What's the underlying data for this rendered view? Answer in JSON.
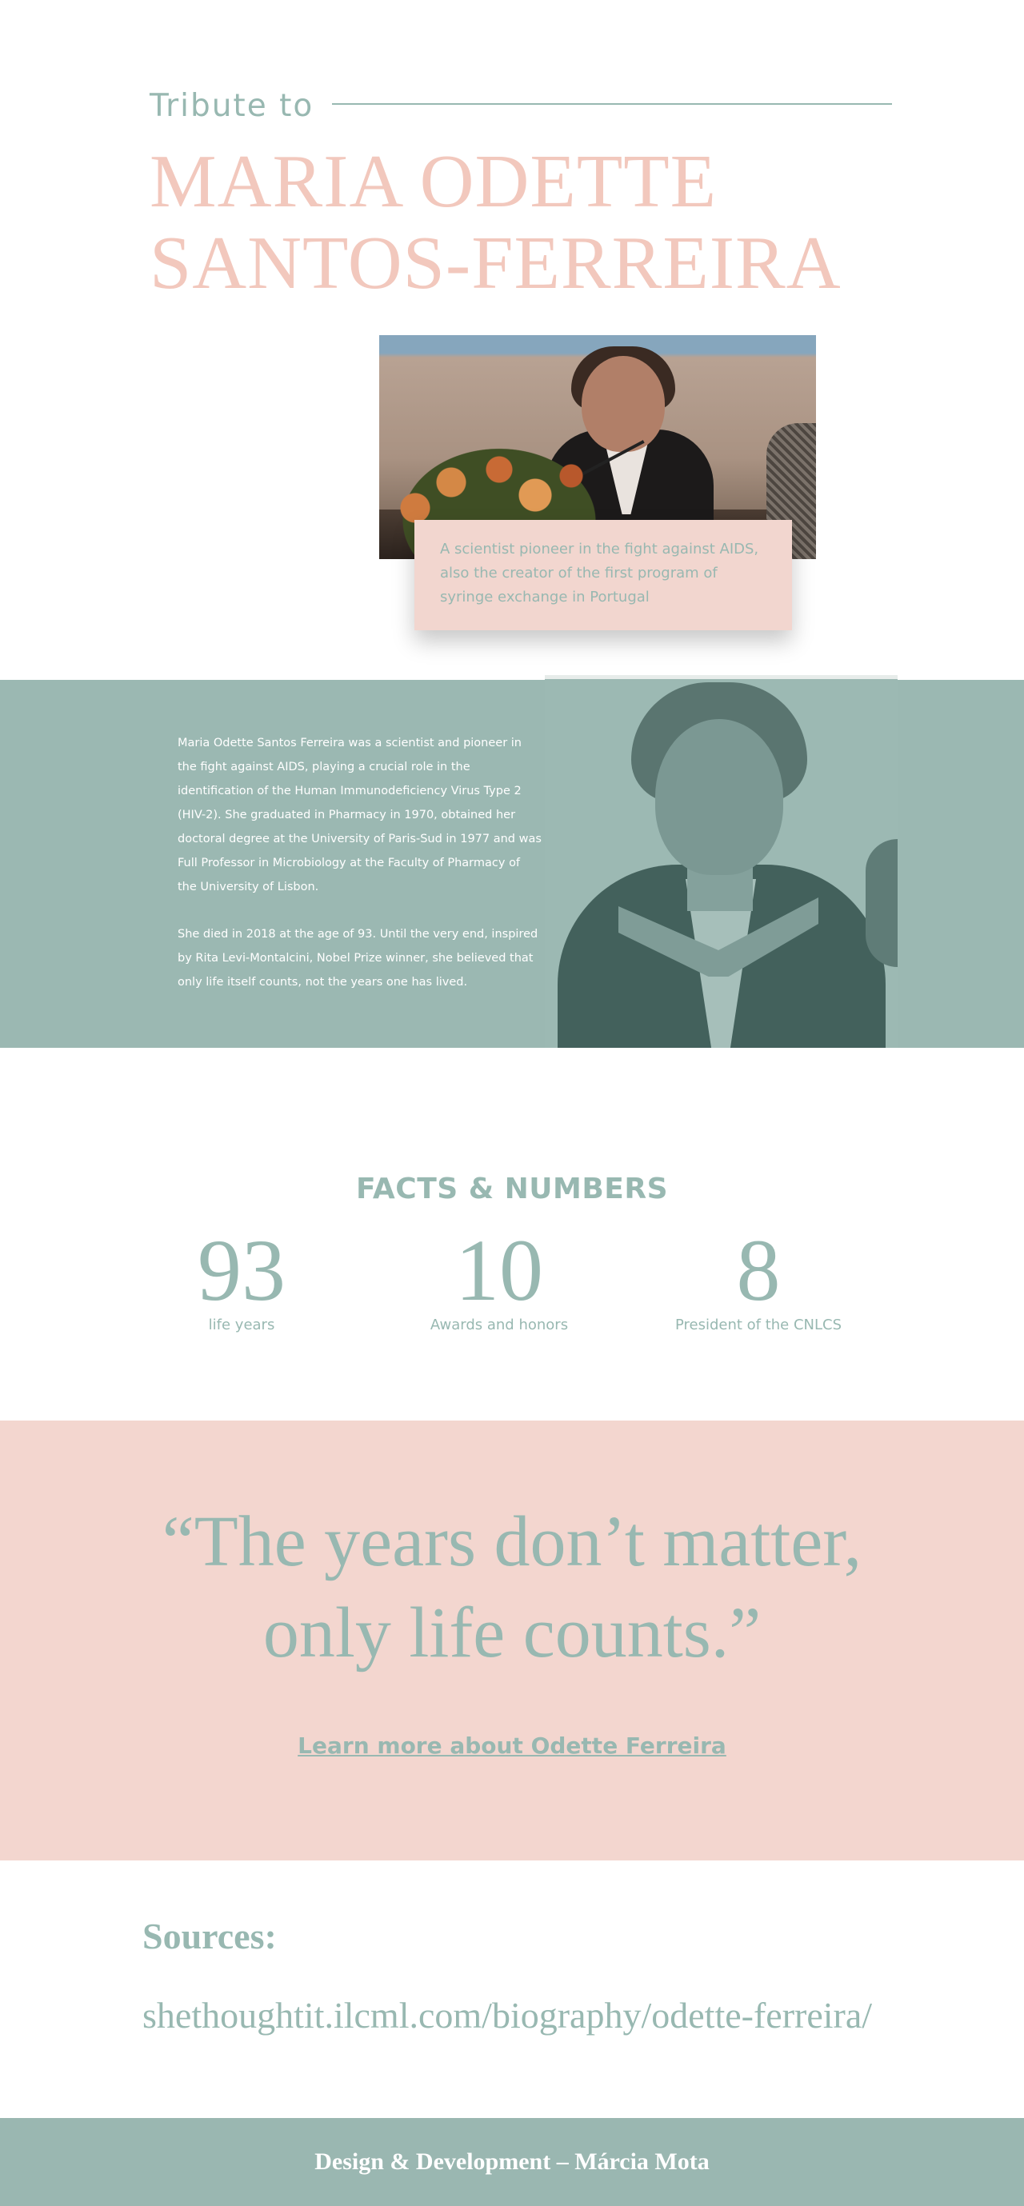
{
  "hero": {
    "tribute_label": "Tribute  to",
    "name_line_1": "MARIA ODETTE",
    "name_line_2": "SANTOS-FERREIRA",
    "photo_caption": " A scientist pioneer in the fight against AIDS, also the creator of the first program of syringe exchange in Portugal"
  },
  "bio": {
    "paragraph_1": "Maria Odette Santos Ferreira was a scientist and pioneer in the fight against AIDS, playing a crucial role in the identification of the Human Immunodeficiency Virus Type 2 (HIV-2). She graduated in Pharmacy in 1970, obtained her doctoral degree at the University of Paris-Sud in 1977 and was Full Professor in Microbiology at the Faculty of Pharmacy of the University of Lisbon.",
    "paragraph_2": "She died in 2018 at the age of 93. Until the very end, inspired by Rita Levi-Montalcini, Nobel Prize winner, she believed that only life itself counts, not the years one has lived."
  },
  "facts": {
    "title": "FACTS & NUMBERS",
    "items": [
      {
        "number": "93",
        "label": "life years"
      },
      {
        "number": "10",
        "label": "Awards and honors"
      },
      {
        "number": "8",
        "label": "President of the CNLCS"
      }
    ]
  },
  "quote": {
    "line_1": "“The years don’t matter,",
    "line_2": "only life counts.”",
    "link_label": "Learn more about Odette Ferreira"
  },
  "sources": {
    "title": "Sources:",
    "link": "shethoughtit.ilcml.com/biography/odette-ferreira/"
  },
  "footer": {
    "credit": "Design & Development – Márcia Mota"
  },
  "colors": {
    "accent_sage": "#98b8b1",
    "accent_pink": "#f2c8bd",
    "band_pink": "#f3d6cf",
    "band_sage": "#9bb8b2"
  }
}
